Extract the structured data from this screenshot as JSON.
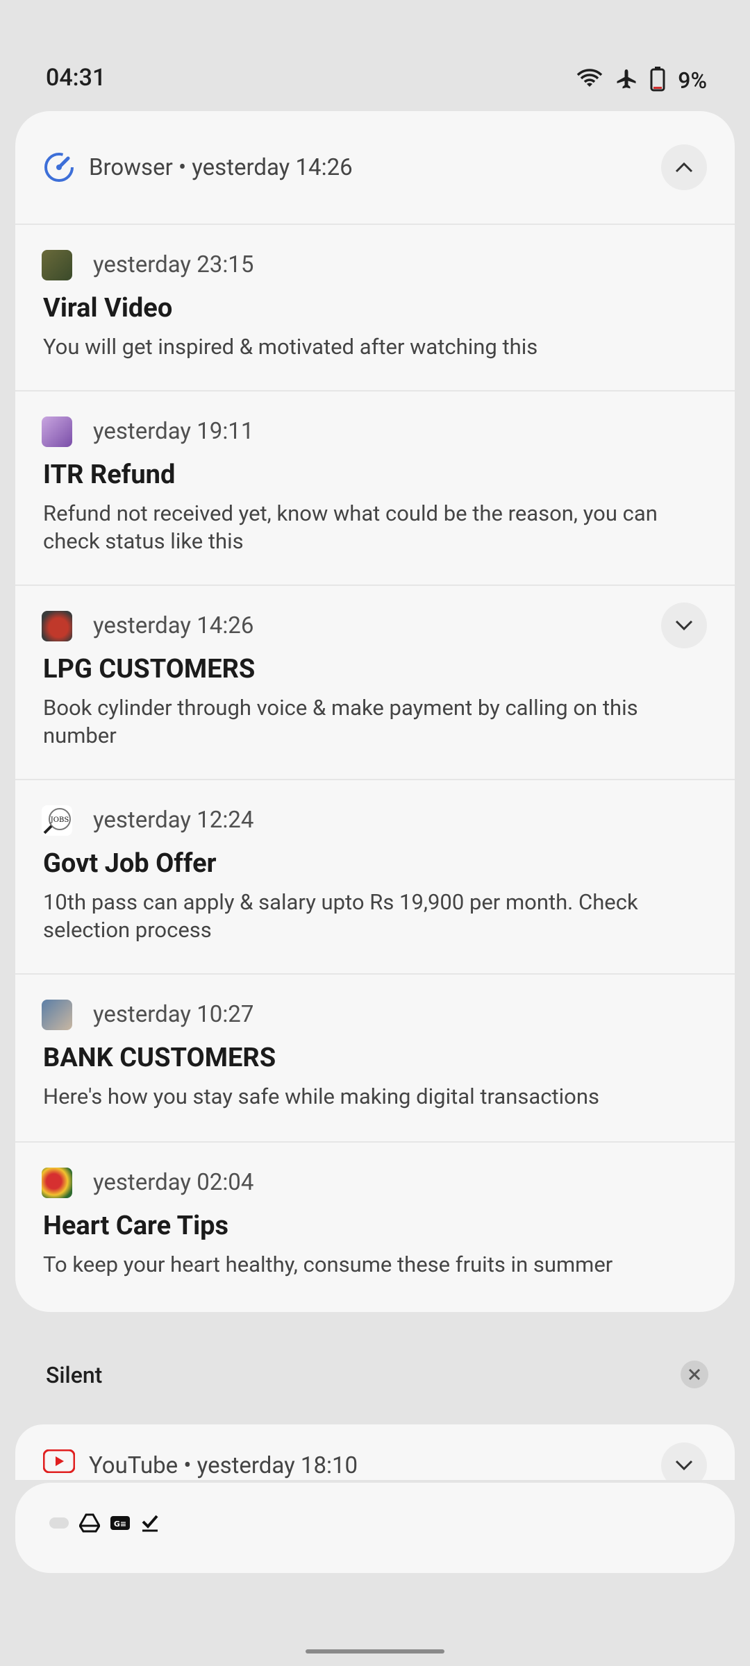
{
  "status_bar": {
    "time": "04:31",
    "battery_percent": "9%"
  },
  "browser_group": {
    "title": "Browser • yesterday 14:26",
    "notifications": [
      {
        "time": "yesterday 23:15",
        "title": "Viral Video",
        "body": "You will get inspired & motivated after watching this"
      },
      {
        "time": "yesterday 19:11",
        "title": "ITR Refund",
        "body": "Refund not received yet, know what could be the reason, you can check status like this"
      },
      {
        "time": "yesterday 14:26",
        "title": "LPG CUSTOMERS",
        "body": "Book cylinder through voice & make payment by calling on this number"
      },
      {
        "time": "yesterday 12:24",
        "title": "Govt Job Offer",
        "body": "10th pass can apply & salary upto Rs 19,900 per month. Check selection process"
      },
      {
        "time": "yesterday 10:27",
        "title": "BANK CUSTOMERS",
        "body": "Here's how you stay safe while making digital transactions"
      },
      {
        "time": "yesterday 02:04",
        "title": "Heart Care Tips",
        "body": "To keep your heart healthy, consume these fruits in summer"
      }
    ]
  },
  "silent_section": {
    "label": "Silent"
  },
  "youtube_notification": {
    "title": "YouTube • yesterday 18:10"
  },
  "colors": {
    "browser_accent": "#3d6fd8",
    "youtube_red": "#e02020"
  }
}
